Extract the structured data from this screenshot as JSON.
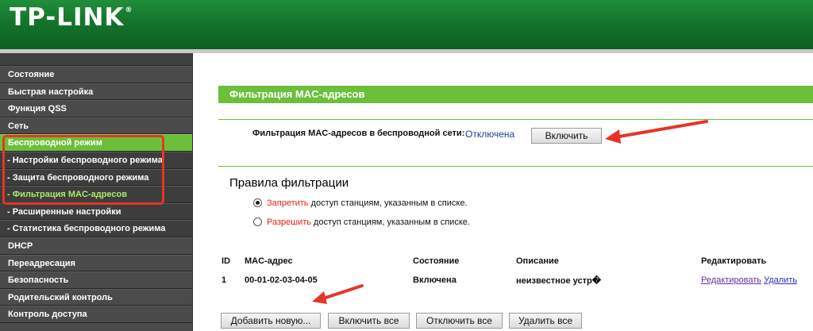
{
  "header": {
    "logo": "TP-LINK",
    "logo_mark": "®"
  },
  "sidebar": {
    "items": [
      {
        "label": "Состояние"
      },
      {
        "label": "Быстрая настройка"
      },
      {
        "label": "Функция QSS"
      },
      {
        "label": "Сеть"
      },
      {
        "label": "Беспроводной режим"
      },
      {
        "label": "- Настройки беспроводного режима"
      },
      {
        "label": "- Защита беспроводного режима"
      },
      {
        "label": "- Фильтрация MAC-адресов"
      },
      {
        "label": "- Расширенные настройки"
      },
      {
        "label": "- Статистика беспроводного режима"
      },
      {
        "label": "DHCP"
      },
      {
        "label": "Переадресация"
      },
      {
        "label": "Безопасность"
      },
      {
        "label": "Родительский контроль"
      },
      {
        "label": "Контроль доступа"
      }
    ],
    "active_index": 4,
    "active_sub_index": 7
  },
  "page": {
    "title": "Фильтрация MAC-адресов",
    "filter_label": "Фильтрация MAC-адресов в беспроводной сети:",
    "filter_status": "Отключена",
    "enable_button": "Включить",
    "rules_title": "Правила фильтрации",
    "rule_deny": {
      "keyword": "Запретить",
      "rest": "доступ станциям, указанным в списке.",
      "selected": true
    },
    "rule_allow": {
      "keyword": "Разрешить",
      "rest": "доступ станциям, указанным в списке.",
      "selected": false
    }
  },
  "table": {
    "headers": {
      "id": "ID",
      "mac": "MAC-адрес",
      "state": "Состояние",
      "desc": "Описание",
      "edit": "Редактировать"
    },
    "rows": [
      {
        "id": "1",
        "mac": "00-01-02-03-04-05",
        "state": "Включена",
        "desc": "неизвестное устр�",
        "edit_link": "Редактировать",
        "delete_link": "Удалить"
      }
    ]
  },
  "buttons": {
    "add_new": "Добавить новую...",
    "enable_all": "Включить все",
    "disable_all": "Отключить все",
    "delete_all": "Удалить все"
  },
  "colors": {
    "brand_green": "#6dbe3b",
    "header_green": "#14742c",
    "annotation_red": "#e53527"
  }
}
